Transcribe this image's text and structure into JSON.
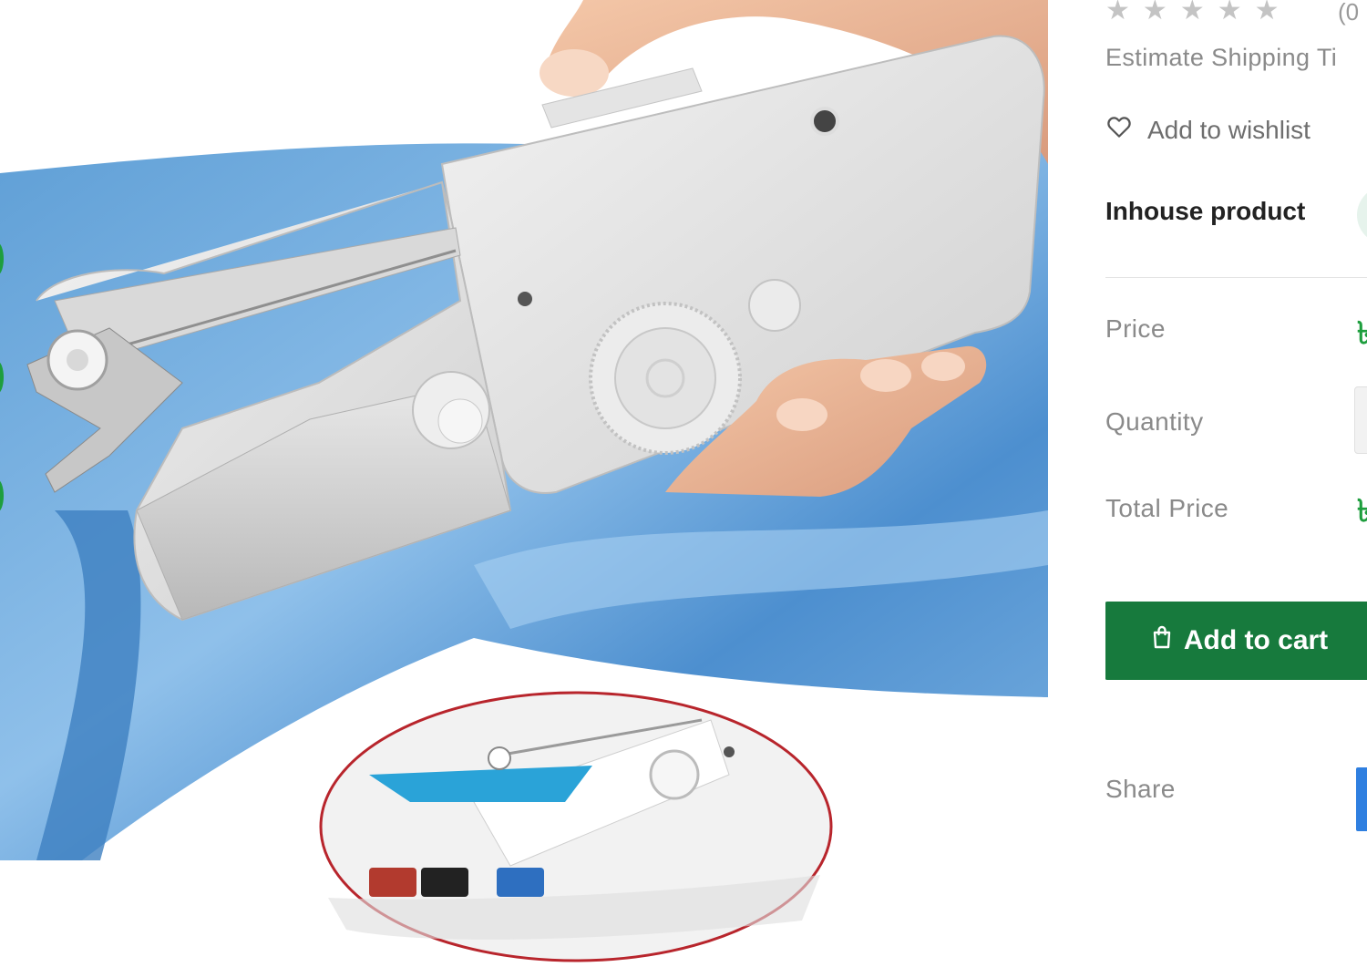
{
  "product": {
    "image_alt": "Handheld sewing machine",
    "rating": {
      "stars": 5,
      "filled": 0,
      "count_text": "(0"
    },
    "shipping_label": "Estimate Shipping Ti",
    "wishlist_label": "Add to wishlist",
    "seller_label": "Inhouse product",
    "price_label": "Price",
    "price_value": "৳",
    "quantity_label": "Quantity",
    "total_label": "Total Price",
    "total_value": "৳",
    "add_to_cart_label": "Add to cart",
    "share_label": "Share"
  },
  "colors": {
    "accent_green": "#177a3d",
    "price_green": "#1e9e3e",
    "star_gray": "#c4c4c4",
    "share_blue": "#2f7fe0"
  },
  "icons": {
    "wishlist": "heart-outline-icon",
    "cart": "shopping-bag-icon",
    "star": "star-icon"
  }
}
